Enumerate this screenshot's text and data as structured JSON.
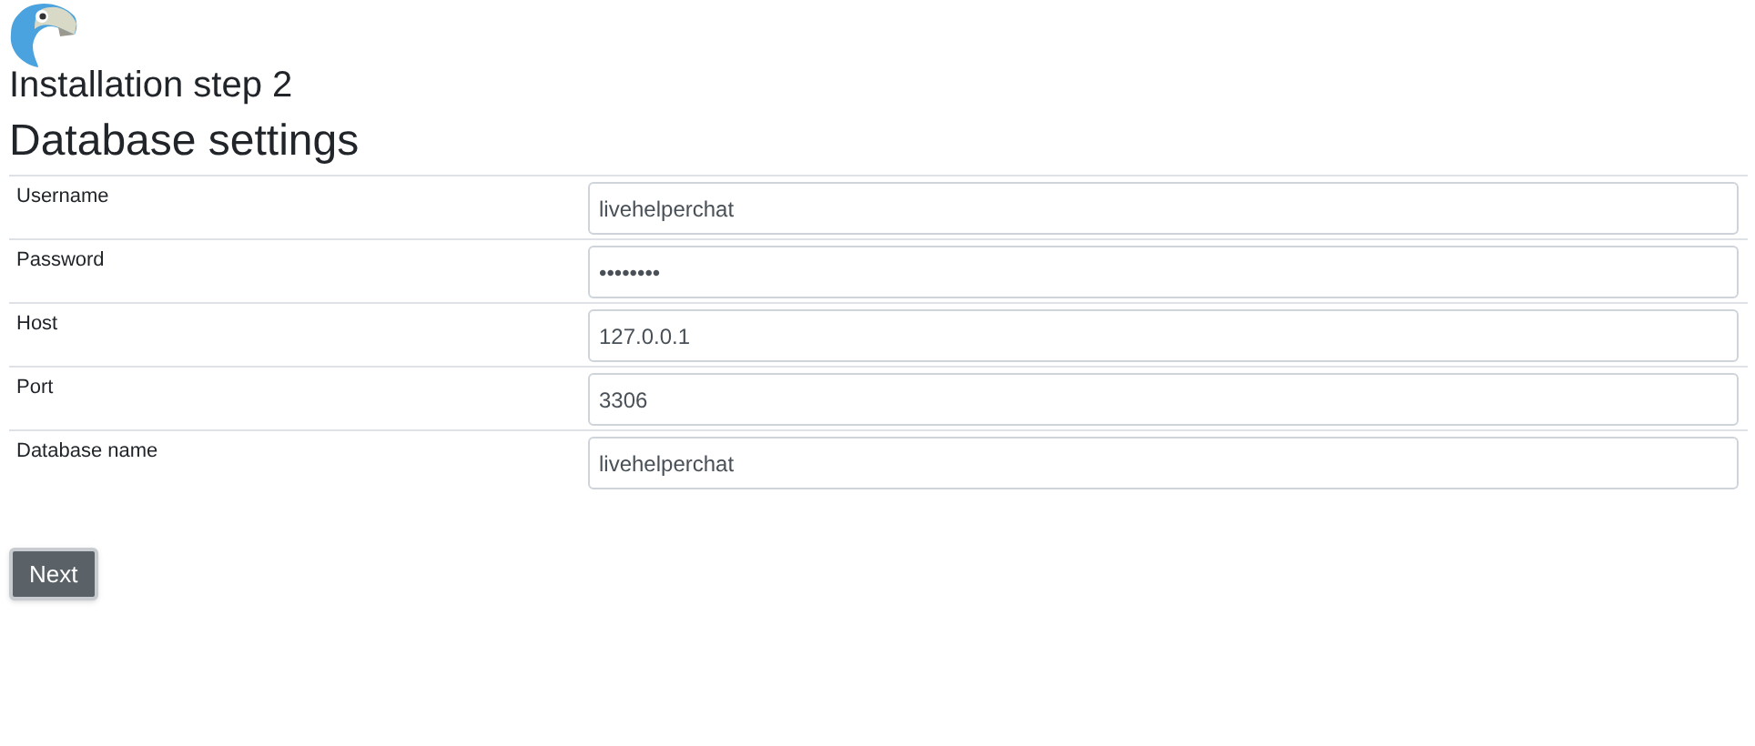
{
  "headings": {
    "step": "Installation step 2",
    "section": "Database settings"
  },
  "fields": [
    {
      "label": "Username",
      "value": "livehelperchat"
    },
    {
      "label": "Password",
      "value": "••••••••"
    },
    {
      "label": "Host",
      "value": "127.0.0.1"
    },
    {
      "label": "Port",
      "value": "3306"
    },
    {
      "label": "Database name",
      "value": "livehelperchat"
    }
  ],
  "button": "Next"
}
